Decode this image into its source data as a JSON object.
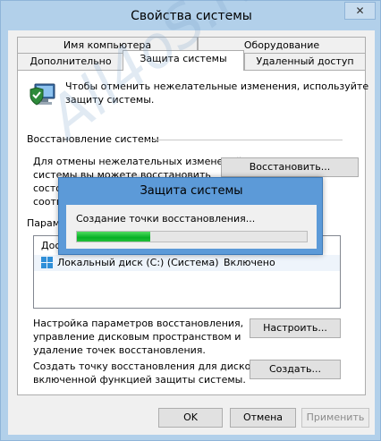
{
  "window": {
    "title": "Свойства системы",
    "close_glyph": "✕"
  },
  "tabs": {
    "row_top": [
      {
        "label": "Имя компьютера"
      },
      {
        "label": "Оборудование"
      }
    ],
    "row_bottom": [
      {
        "label": "Дополнительно"
      },
      {
        "label": "Защита системы"
      },
      {
        "label": "Удаленный доступ"
      }
    ]
  },
  "intro": {
    "text_line1": "Чтобы отменить нежелательные изменения, используйте",
    "text_line2": "защиту системы."
  },
  "restore": {
    "heading": "Восстановление системы",
    "desc_line1": "Для отмены нежелательных изменений",
    "desc_line2": "системы вы можете восстановить",
    "desc_line3": "состо",
    "desc_line4": "соотве",
    "button_label": "Восстановить..."
  },
  "params": {
    "heading_partial": "Параме",
    "list_header_partial": "Дос",
    "disk_row": {
      "name": "Локальный диск (C:) (Система)",
      "status": "Включено"
    }
  },
  "configure": {
    "desc_line1": "Настройка параметров восстановления,",
    "desc_line2": "управление дисковым пространством и",
    "desc_line3": "удаление точек восстановления.",
    "button_label": "Настроить..."
  },
  "create": {
    "desc_line1": "Создать точку восстановления для дисков с",
    "desc_line2": "включенной функцией защиты системы.",
    "button_label": "Создать..."
  },
  "footer": {
    "ok_label": "OK",
    "cancel_label": "Отмена",
    "apply_label": "Применить"
  },
  "popup": {
    "title": "Защита системы",
    "message": "Создание точки восстановления...",
    "progress": 0.32
  },
  "watermark": {
    "text": "All4oS.RU"
  },
  "colors": {
    "title_bar": "#b2d0ea",
    "popup_border": "#5c9ad8",
    "progress": "#06b025"
  },
  "icons": {
    "protection": "computer-shield-icon",
    "disk": "windows-disk-icon"
  }
}
